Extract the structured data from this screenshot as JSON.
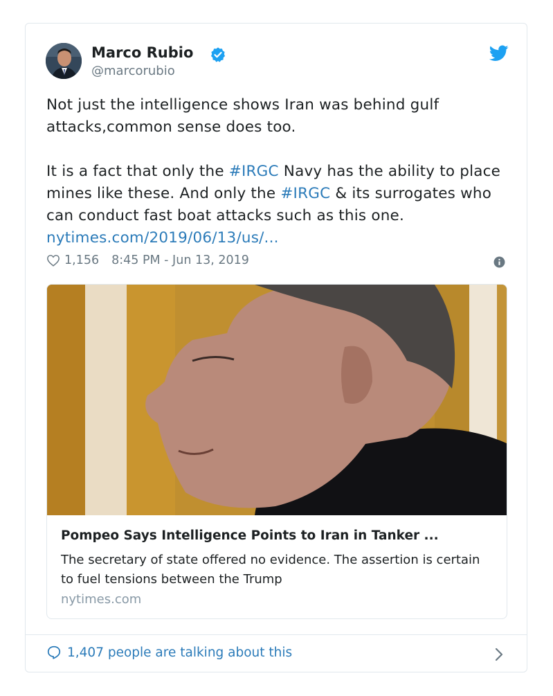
{
  "tweet": {
    "author_name": "Marco Rubio",
    "author_handle": "@marcorubio",
    "text_p1": "Not just the intelligence shows Iran was behind gulf attacks,common sense does too.",
    "text_p2": {
      "a": "It is a fact that only the ",
      "tag1": "#IRGC",
      "b": " Navy has the ability to place mines like these. And only the ",
      "tag2": "#IRGC",
      "c": " & its surrogates who can conduct fast boat attacks such as this one. ",
      "link": "nytimes.com/2019/06/13/us/..."
    },
    "likes": "1,156",
    "timestamp": "8:45 PM - Jun 13, 2019"
  },
  "card": {
    "title": "Pompeo Says Intelligence Points to Iran in Tanker ...",
    "description": "The secretary of state offered no evidence. The assertion is certain to fuel tensions between the Trump",
    "domain": "nytimes.com"
  },
  "footer": {
    "talking": "1,407 people are talking about this"
  },
  "colors": {
    "link": "#2b7bb9",
    "muted": "#697882",
    "verified": "#1da1f2",
    "border": "#e1e8ed"
  },
  "icons": [
    "verified-badge-icon",
    "twitter-bird-icon",
    "heart-icon",
    "info-icon",
    "speech-bubble-icon",
    "chevron-right-icon"
  ]
}
